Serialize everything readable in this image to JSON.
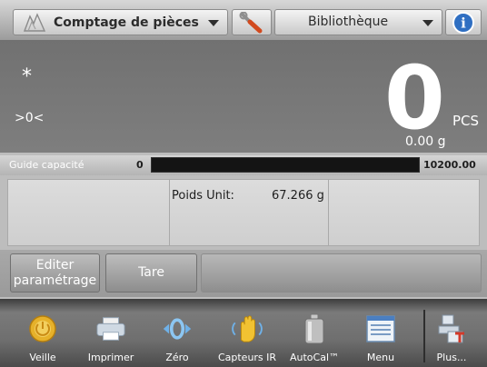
{
  "topbar": {
    "app_label": "Comptage de pièces",
    "library_label": "Bibliothèque",
    "info_glyph": "i"
  },
  "display": {
    "stability_indicator": "*",
    "zero_indicator": ">0<",
    "main_value": "0",
    "unit": "PCS",
    "secondary_value": "0.00 g"
  },
  "capacity": {
    "label": "Guide capacité",
    "min": "0",
    "max": "10200.00",
    "fill_fraction": 0.0
  },
  "panel": {
    "unit_weight_label": "Poids Unit:",
    "unit_weight_value": "67.266 g"
  },
  "actions": {
    "edit_line1": "Editer",
    "edit_line2": "paramétrage",
    "tare": "Tare"
  },
  "toolbar": {
    "items": [
      {
        "label": "Veille",
        "icon": "standby-icon"
      },
      {
        "label": "Imprimer",
        "icon": "printer-icon"
      },
      {
        "label": "Zéro",
        "icon": "zero-icon"
      },
      {
        "label": "Capteurs IR",
        "icon": "ir-sensor-icon"
      },
      {
        "label": "AutoCal™",
        "icon": "calibration-weight-icon"
      },
      {
        "label": "Menu",
        "icon": "menu-icon"
      },
      {
        "label": "Plus...",
        "icon": "more-icon"
      }
    ]
  },
  "colors": {
    "display_bg": "#7a7a7a",
    "capacity_track": "#141414",
    "accent_blue": "#2a7bd8",
    "standby_yellow": "#e6b12a"
  }
}
